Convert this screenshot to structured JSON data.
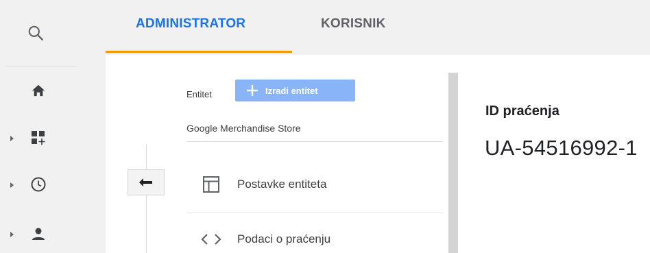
{
  "nav": {
    "search_icon": "search-icon",
    "items": [
      {
        "icon": "home-icon",
        "expandable": false
      },
      {
        "icon": "dashboard-add-icon",
        "expandable": true
      },
      {
        "icon": "clock-icon",
        "expandable": true
      },
      {
        "icon": "person-icon",
        "expandable": true
      }
    ]
  },
  "tabs": [
    {
      "label": "ADMINISTRATOR",
      "active": true
    },
    {
      "label": "KORISNIK",
      "active": false
    }
  ],
  "entity": {
    "label": "Entitet",
    "create_button": "Izradi entitet",
    "account_name": "Google Merchandise Store"
  },
  "menu": [
    {
      "icon": "property-settings-icon",
      "label": "Postavke entiteta"
    },
    {
      "icon": "code-brackets-icon",
      "label": "Podaci o praćenju"
    }
  ],
  "tracking": {
    "title": "ID praćenja",
    "value": "UA-54516992-1"
  },
  "colors": {
    "accent": "#1a73e8",
    "tab_underline": "#f29900",
    "create_button_bg": "#8ab4f8",
    "rail_bg": "#f1f1f1"
  }
}
